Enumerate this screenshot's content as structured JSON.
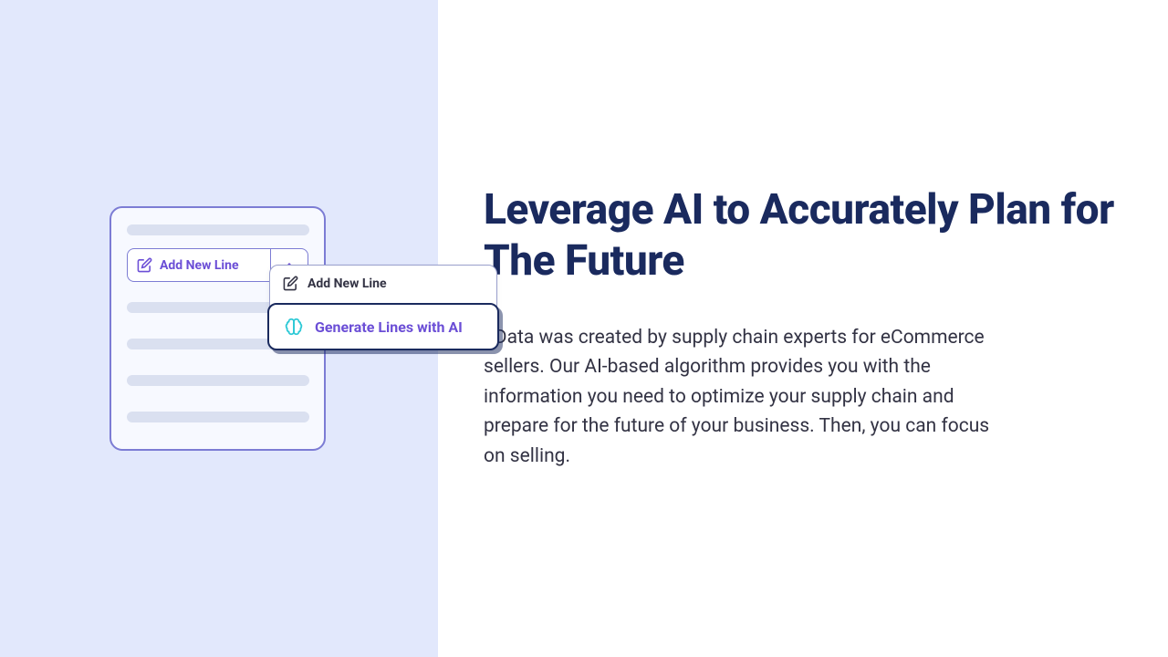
{
  "content": {
    "headline": "Leverage AI to Accurately Plan for The Future",
    "description": "8Data was created by supply chain experts for eCommerce sellers. Our AI-based algorithm provides you with the information you need to optimize your supply chain and prepare for the future of your business. Then, you can focus on selling."
  },
  "ui": {
    "addNewLineLabel": "Add New Line",
    "menuAddNewLine": "Add New Line",
    "menuGenerateAI": "Generate Lines with AI"
  },
  "colors": {
    "leftBg": "#e2e8fc",
    "headline": "#1a2a5e",
    "purpleBorder": "#7c7cd4",
    "purpleText": "#6b4ed6",
    "teal": "#2ec9d6"
  }
}
